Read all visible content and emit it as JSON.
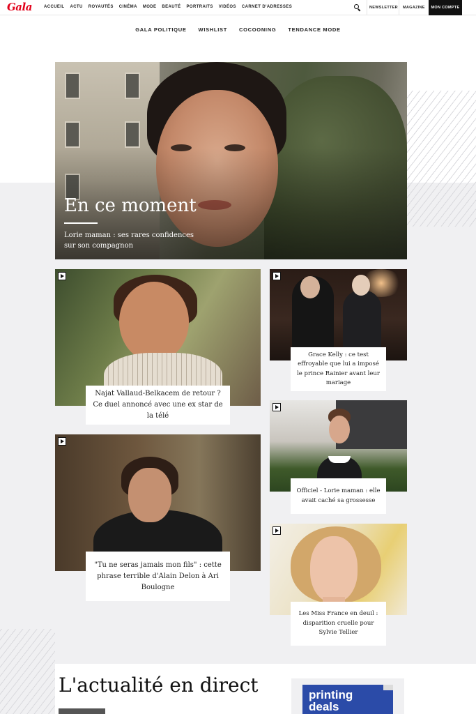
{
  "header": {
    "logo": "Gala",
    "nav": [
      "ACCUEIL",
      "ACTU",
      "ROYAUTÉS",
      "CINÉMA",
      "MODE",
      "BEAUTÉ",
      "PORTRAITS",
      "VIDÉOS",
      "CARNET D'ADRESSES"
    ],
    "search_icon": "search-icon",
    "newsletter": "NEWSLETTER",
    "magazine": "MAGAZINE",
    "account": "MON COMPTE"
  },
  "subnav": [
    "GALA POLITIQUE",
    "WISHLIST",
    "COCOONING",
    "TENDANCE MODE"
  ],
  "hero": {
    "title": "En ce moment",
    "text": "Lorie maman : ses rares confidences sur son compagnon"
  },
  "articles": [
    {
      "caption": "Najat Vallaud-Belkacem de retour ? Ce duel annoncé avec une ex star de la télé",
      "icon": "video-play-icon"
    },
    {
      "caption": "Grace Kelly : ce test effroyable que lui a imposé le prince Rainier avant leur mariage",
      "icon": "video-play-icon"
    },
    {
      "caption": "Officiel - Lorie maman : elle avait caché sa grossesse",
      "icon": "video-play-icon"
    },
    {
      "caption": "\"Tu ne seras jamais mon fils\" : cette phrase terrible d'Alain Delon à Ari Boulogne",
      "icon": "video-play-icon"
    },
    {
      "caption": "Les Miss France en deuil : disparition cruelle pour Sylvie Tellier",
      "icon": "video-play-icon"
    }
  ],
  "live": {
    "title": "L'actualité en direct"
  },
  "ad": {
    "text": "printing\ndeals"
  },
  "colors": {
    "brand": "#e2001a",
    "page_grey": "#f0f0f2",
    "account_bg": "#111111",
    "ad_blue": "#2b4ba8"
  }
}
